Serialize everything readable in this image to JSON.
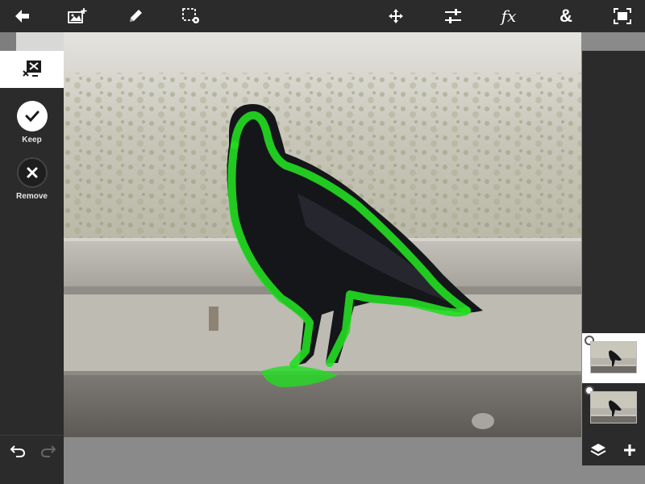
{
  "toolbar": {
    "left_icons": [
      "back-arrow-icon",
      "add-image-icon",
      "pencil-icon",
      "selection-settings-icon"
    ],
    "right_icons": [
      "move-icon",
      "adjustments-icon",
      "fx-icon",
      "ampersand-icon",
      "fit-screen-icon"
    ],
    "fx_label": "fx",
    "blend_label": "&"
  },
  "left_panel": {
    "tool_icon": "extract-tool-icon",
    "keep_label": "Keep",
    "remove_label": "Remove",
    "active": "keep",
    "undo_icon": "undo-icon",
    "redo_icon": "redo-icon"
  },
  "right_panel": {
    "layers": [
      {
        "thumb_icon": "crow-thumbnail-icon",
        "selected": true
      },
      {
        "thumb_icon": "crow-thumbnail-icon",
        "selected": false
      }
    ],
    "layers_icon": "layers-icon",
    "add_icon": "plus-icon"
  },
  "colors": {
    "toolbar_bg": "#2b2b2b",
    "selection_stroke": "#22dd22",
    "panel_active_bg": "#ffffff"
  }
}
